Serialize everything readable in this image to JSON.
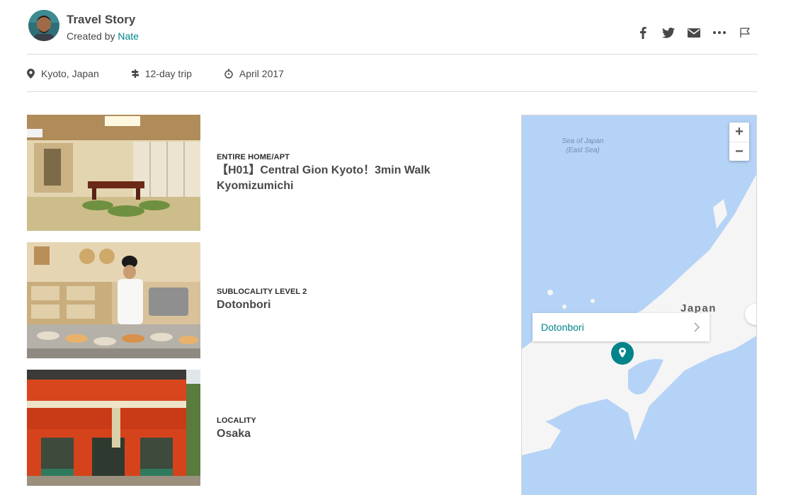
{
  "header": {
    "title": "Travel Story",
    "created_by_prefix": "Created by ",
    "author": "Nate",
    "share_icons": [
      "facebook-icon",
      "twitter-icon",
      "email-icon",
      "more-icon",
      "flag-icon"
    ]
  },
  "meta": {
    "location": "Kyoto, Japan",
    "duration": "12-day trip",
    "date": "April 2017"
  },
  "items": [
    {
      "kicker": "ENTIRE HOME/APT",
      "title": "【H01】Central Gion Kyoto！3min Walk Kyomizumichi",
      "photo": "tatami room with low table and green cushions"
    },
    {
      "kicker": "SUBLOCALITY LEVEL 2",
      "title": "Dotonbori",
      "photo": "sushi chef at conveyor belt counter"
    },
    {
      "kicker": "LOCALITY",
      "title": "Osaka",
      "photo": "red shrine gate"
    }
  ],
  "map": {
    "sea_label_1": "Sea of Japan",
    "sea_label_2": "(East Sea)",
    "country_label": "Japan",
    "popup_label": "Dotonbori",
    "zoom_in": "+",
    "zoom_out": "−",
    "water_color": "#b5d3f6",
    "land_color": "#f5f5f5",
    "pin_color": "#008489"
  },
  "colors": {
    "accent": "#008489",
    "text": "#484848",
    "divider": "#dbdbdb"
  }
}
